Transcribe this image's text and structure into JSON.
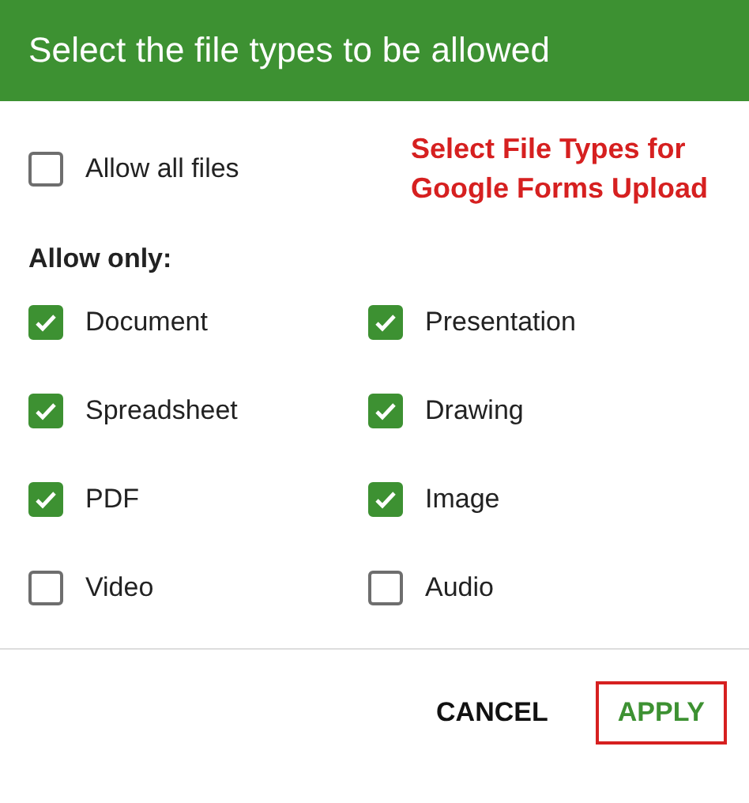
{
  "dialog": {
    "title": "Select the file types to be allowed"
  },
  "annotation": "Select File Types for Google Forms Upload",
  "allow_all": {
    "label": "Allow all files",
    "checked": false
  },
  "allow_only": {
    "label": "Allow only:",
    "types": [
      {
        "label": "Document",
        "checked": true
      },
      {
        "label": "Presentation",
        "checked": true
      },
      {
        "label": "Spreadsheet",
        "checked": true
      },
      {
        "label": "Drawing",
        "checked": true
      },
      {
        "label": "PDF",
        "checked": true
      },
      {
        "label": "Image",
        "checked": true
      },
      {
        "label": "Video",
        "checked": false
      },
      {
        "label": "Audio",
        "checked": false
      }
    ]
  },
  "buttons": [
    {
      "label": "CANCEL",
      "kind": "plain",
      "highlighted": false
    },
    {
      "label": "APPLY",
      "kind": "primary",
      "highlighted": true
    }
  ]
}
